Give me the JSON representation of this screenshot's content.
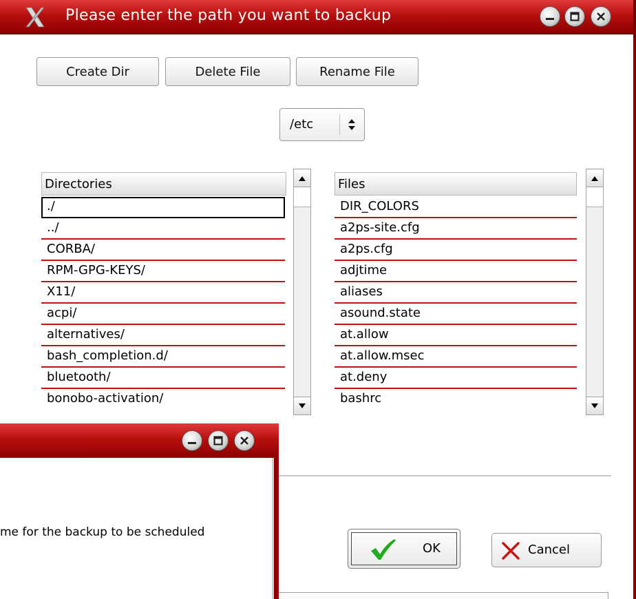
{
  "dialog": {
    "title": "Please enter the path you want to backup",
    "toolbar": {
      "create_dir": "Create Dir",
      "delete_file": "Delete File",
      "rename_file": "Rename File"
    },
    "path_combo": {
      "value": "/etc"
    },
    "directories": {
      "header": "Directories",
      "items": [
        "./",
        "../",
        "CORBA/",
        "RPM-GPG-KEYS/",
        "X11/",
        "acpi/",
        "alternatives/",
        "bash_completion.d/",
        "bluetooth/",
        "bonobo-activation/"
      ]
    },
    "files": {
      "header": "Files",
      "items": [
        "DIR_COLORS",
        "a2ps-site.cfg",
        "a2ps.cfg",
        "adjtime",
        "aliases",
        "asound.state",
        "at.allow",
        "at.allow.msec",
        "at.deny",
        "bashrc"
      ]
    },
    "ok_label": "OK",
    "cancel_label": "Cancel"
  },
  "background_window": {
    "text": "me for the backup to be scheduled"
  },
  "colors": {
    "titlebar": "#b80f0f",
    "row_divider": "#c01010",
    "ok_check": "#22aa22",
    "cancel_x": "#cc1111"
  }
}
